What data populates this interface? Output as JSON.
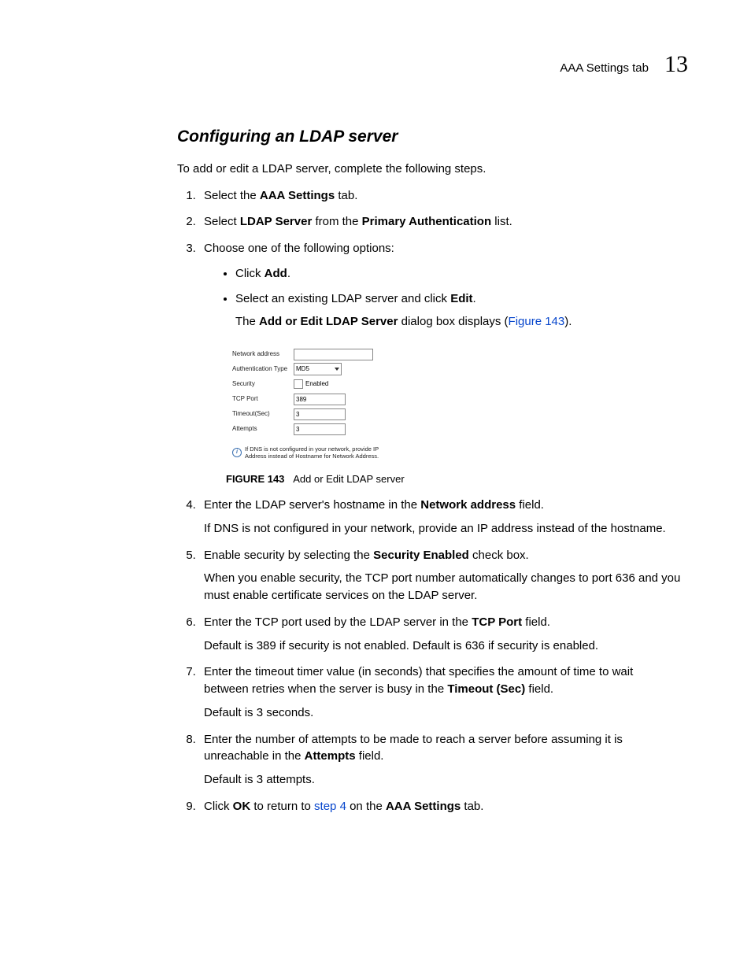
{
  "header": {
    "label": "AAA Settings tab",
    "chapter": "13"
  },
  "title": "Configuring an LDAP server",
  "intro": "To add or edit a LDAP server, complete the following steps.",
  "step1": {
    "pre": "Select the ",
    "b1": "AAA Settings",
    "post": " tab."
  },
  "step2": {
    "pre": "Select ",
    "b1": "LDAP Server",
    "mid": " from the ",
    "b2": "Primary Authentication",
    "post": " list."
  },
  "step3": {
    "lead": "Choose one of the following options:",
    "b1_pre": "Click ",
    "b1_b": "Add",
    "b1_post": ".",
    "b2_pre": "Select an existing LDAP server and click ",
    "b2_b": "Edit",
    "b2_post": ".",
    "follow_pre": "The ",
    "follow_b": "Add or Edit LDAP Server",
    "follow_mid": " dialog box displays (",
    "follow_link": "Figure 143",
    "follow_end": ")."
  },
  "figure": {
    "labels": {
      "net": "Network address",
      "auth": "Authentication Type",
      "sec": "Security",
      "tcp": "TCP Port",
      "timeout": "Timeout(Sec)",
      "attempts": "Attempts"
    },
    "values": {
      "auth": "MD5",
      "sec_chk": "Enabled",
      "tcp": "389",
      "timeout": "3",
      "attempts": "3"
    },
    "note": "If DNS is not configured in your network, provide IP Address instead of Hostname for Network Address."
  },
  "caption": {
    "label": "FIGURE 143",
    "text": "Add or Edit LDAP server"
  },
  "step4": {
    "pre": "Enter the LDAP server's hostname in the ",
    "b1": "Network address",
    "post": " field.",
    "para": "If DNS is not configured in your network, provide an IP address instead of the hostname."
  },
  "step5": {
    "pre": "Enable security by selecting the ",
    "b1": "Security Enabled",
    "post": " check box.",
    "para": "When you enable security, the TCP port number automatically changes to port 636 and you must enable certificate services on the LDAP server."
  },
  "step6": {
    "pre": "Enter the TCP port used by the LDAP server in the ",
    "b1": "TCP Port",
    "post": " field.",
    "para": "Default is 389 if security is not enabled. Default is 636 if security is enabled."
  },
  "step7": {
    "pre": "Enter the timeout timer value (in seconds) that specifies the amount of time to wait between retries when the server is busy in the ",
    "b1": "Timeout (Sec)",
    "post": " field.",
    "para": "Default is 3 seconds."
  },
  "step8": {
    "pre": "Enter the number of attempts to be made to reach a server before assuming it is unreachable in the ",
    "b1": "Attempts",
    "post": " field.",
    "para": "Default is 3 attempts."
  },
  "step9": {
    "pre": "Click ",
    "b1": "OK",
    "mid": " to return to ",
    "link": "step 4",
    "mid2": " on the ",
    "b2": "AAA Settings",
    "post": " tab."
  }
}
